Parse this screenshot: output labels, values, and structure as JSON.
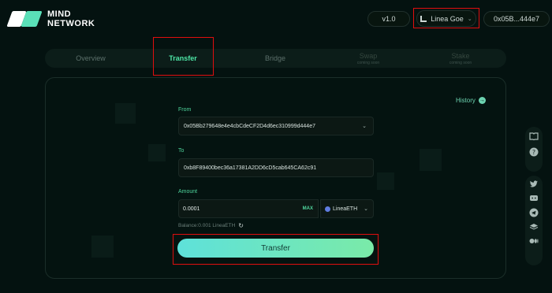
{
  "brand": {
    "line1": "MIND",
    "line2": "NETWORK"
  },
  "header": {
    "version": "v1.0",
    "network": "Linea Goe",
    "account": "0x05B...444e7"
  },
  "tabs": [
    {
      "label": "Transfer",
      "active": true
    },
    {
      "label": "Overview"
    },
    {
      "label": "Bridge"
    },
    {
      "label": "Swap",
      "sub": "coming soon"
    },
    {
      "label": "Stake",
      "sub": "coming soon"
    }
  ],
  "history": {
    "label": "History"
  },
  "form": {
    "from_label": "From",
    "from_value": "0x05Bb279648e4e4cbCdeCF2D4d6ec310999d444e7",
    "to_label": "To",
    "to_value": "0xb8F89400bec36a17381A2DD6cD5cab645CA62c91",
    "amount_label": "Amount",
    "amount_value": "0.0001",
    "max_label": "MAX",
    "token": "LineaETH",
    "balance": "Balance:0.001 LineaETH",
    "submit_label": "Transfer"
  },
  "colors": {
    "background": "#041210",
    "accent": "#4de6a6",
    "button_gradient_start": "#5ee1da",
    "button_gradient_end": "#7aeaa8",
    "highlight_box": "#e10e0e"
  },
  "icons": {
    "social_group_1": [
      "book-icon",
      "help-icon"
    ],
    "social_group_2": [
      "twitter-icon",
      "discord-icon",
      "telegram-icon",
      "stack-icon",
      "medium-icon"
    ]
  }
}
